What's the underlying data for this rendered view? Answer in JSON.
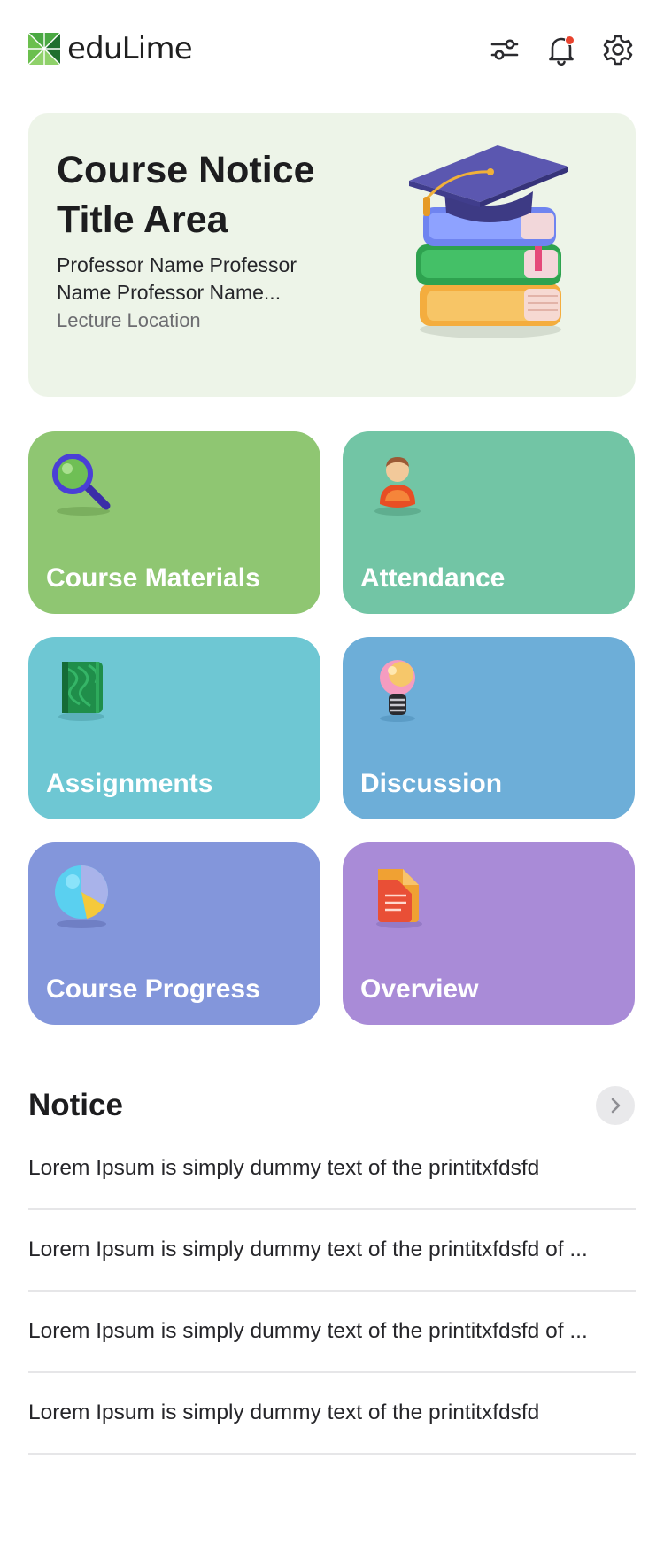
{
  "app": {
    "logo_text": "eduLime"
  },
  "header": {
    "icons": [
      "filter-sliders-icon",
      "bell-icon",
      "gear-icon"
    ],
    "has_notification": true
  },
  "hero": {
    "title": "Course Notice Title Area",
    "professor": "Professor Name Professor Name Professor Name...",
    "location": "Lecture Location",
    "illustration": "graduation-books-icon"
  },
  "tiles": [
    {
      "label": "Course Materials",
      "icon": "magnifier-icon",
      "color": "#8fc672"
    },
    {
      "label": "Attendance",
      "icon": "person-icon",
      "color": "#72c5a5"
    },
    {
      "label": "Assignments",
      "icon": "notebook-icon",
      "color": "#6ec7d3"
    },
    {
      "label": "Discussion",
      "icon": "lightbulb-icon",
      "color": "#6daed8"
    },
    {
      "label": "Course Progress",
      "icon": "pie-chart-icon",
      "color": "#8396db"
    },
    {
      "label": "Overview",
      "icon": "document-icon",
      "color": "#a98bd7"
    }
  ],
  "notice": {
    "title": "Notice",
    "items": [
      "Lorem Ipsum is simply dummy text of the printitxfdsfd",
      "Lorem Ipsum is simply dummy text of the printitxfdsfd of ...",
      "Lorem Ipsum is simply dummy text of the printitxfdsfd of ...",
      "Lorem Ipsum is simply dummy text of the printitxfdsfd"
    ]
  },
  "colors": {
    "brand_green": "#3f9a3c",
    "hero_bg": "#edf4e8",
    "notification_dot": "#e8432e"
  }
}
